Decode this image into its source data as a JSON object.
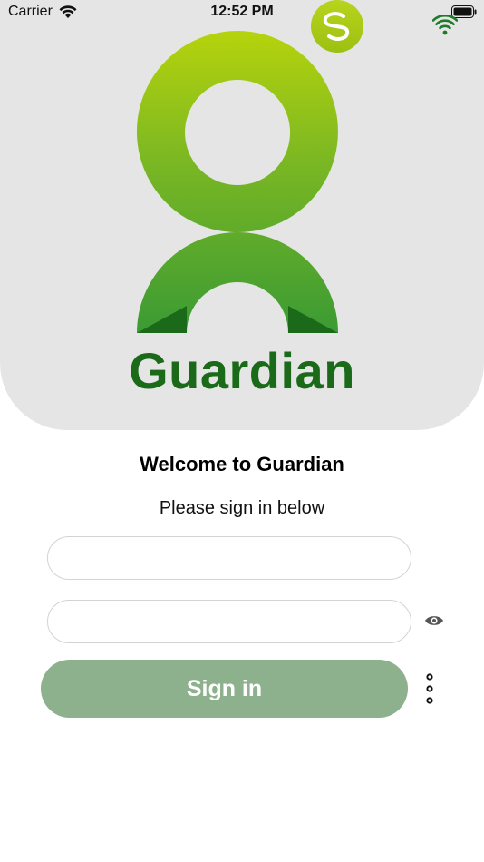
{
  "status_bar": {
    "carrier": "Carrier",
    "time": "12:52 PM",
    "icons": [
      "wifi-icon",
      "battery-icon"
    ]
  },
  "header": {
    "brand_name": "Guardian",
    "logo_icon": "guardian-person-logo",
    "badge_icon": "s-swirl-badge-icon",
    "signal_icon": "wifi-signal-icon",
    "colors": {
      "panel_background": "#e5e5e5",
      "logo_top": "#b3d10a",
      "logo_bottom": "#3a9a34",
      "brand_text": "#1a6a1a"
    }
  },
  "login": {
    "welcome": "Welcome to Guardian",
    "subtitle": "Please sign in below",
    "username": {
      "value": "",
      "placeholder": ""
    },
    "password": {
      "value": "",
      "placeholder": ""
    },
    "show_password_icon": "eye-icon",
    "signin_label": "Sign in",
    "more_icon": "vertical-more-icon",
    "colors": {
      "signin_background": "#8cb18c",
      "signin_text": "#ffffff"
    }
  }
}
